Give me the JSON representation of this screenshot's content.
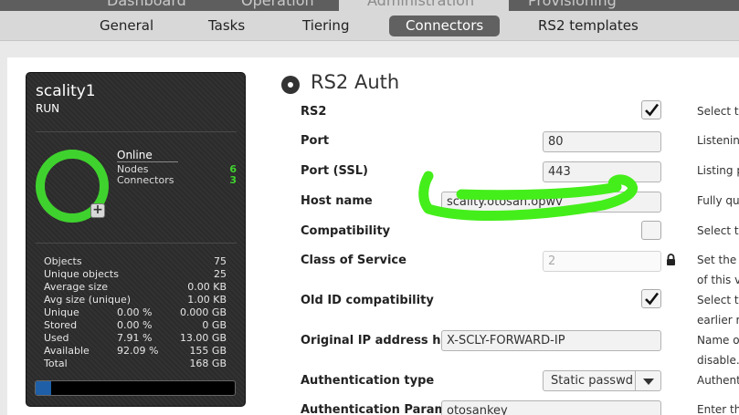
{
  "topnav": {
    "tabs": [
      "Dashboard",
      "Operation",
      "Administration",
      "Provisioning"
    ]
  },
  "subnav": {
    "tabs": [
      "General",
      "Tasks",
      "Tiering",
      "Connectors",
      "RS2 templates"
    ],
    "active": "Connectors"
  },
  "server": {
    "name": "scality1",
    "state": "RUN",
    "status": "Online",
    "nodes_label": "Nodes",
    "nodes_value": "6",
    "connectors_label": "Connectors",
    "connectors_value": "3",
    "ring_color": "#3fd22e",
    "usage_fraction": 0.0791,
    "stats": [
      {
        "label": "Objects",
        "pct": "",
        "value": "75"
      },
      {
        "label": "Unique objects",
        "pct": "",
        "value": "25"
      },
      {
        "label": "Average size",
        "pct": "",
        "value": "0.00 KB"
      },
      {
        "label": "Avg size (unique)",
        "pct": "",
        "value": "1.00 KB"
      },
      {
        "label": "Unique",
        "pct": "0.00 %",
        "value": "0.000 GB"
      },
      {
        "label": "Stored",
        "pct": "0.00 %",
        "value": "0 GB"
      },
      {
        "label": "Used",
        "pct": "7.91 %",
        "value": "13.00 GB"
      },
      {
        "label": "Available",
        "pct": "92.09 %",
        "value": "155 GB"
      },
      {
        "label": "Total",
        "pct": "",
        "value": "168 GB"
      }
    ]
  },
  "form": {
    "title": "RS2 Auth",
    "rs2_label": "RS2",
    "rs2_checked": true,
    "port_label": "Port",
    "port_value": "80",
    "port_ssl_label": "Port (SSL)",
    "port_ssl_value": "443",
    "hostname_label": "Host name",
    "hostname_value": "scality.otosan.opwv",
    "compat_label": "Compatibility",
    "compat_checked": false,
    "cos_label": "Class of Service",
    "cos_value": "2",
    "oldid_label": "Old ID compatibility",
    "oldid_checked": true,
    "origip_label": "Original IP address header",
    "origip_value": "X-SCLY-FORWARD-IP",
    "authtype_label": "Authentication type",
    "authtype_value": "Static passwd",
    "authparam_label": "Authentication Parameter",
    "authparam_value": "otosankey"
  },
  "help": [
    "Select t",
    "Listenin",
    "Listing p",
    "Fully qu",
    "Select t",
    "Set the",
    "of this v",
    "Select t",
    "earlier r",
    "Name o",
    "disable.",
    "Authent",
    "Enter th"
  ],
  "annotation_color": "#44ee1a"
}
